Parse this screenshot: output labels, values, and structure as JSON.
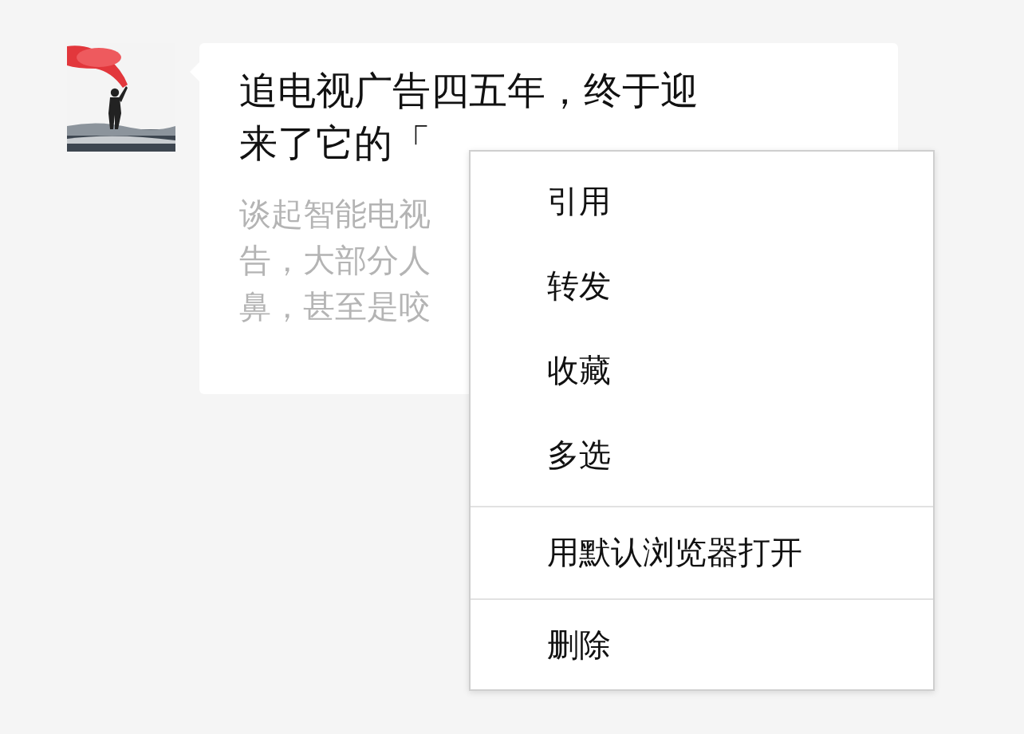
{
  "message": {
    "kind": "picture",
    "title_lines": [
      "追电视广告四五年，终于迎",
      "来了它的「"
    ],
    "description_lines": [
      "谈起智能电视",
      "告，大部分人",
      "鼻，甚至是咬"
    ]
  },
  "context_menu": {
    "sections": [
      {
        "items": [
          "引用",
          "转发",
          "收藏",
          "多选"
        ]
      },
      {
        "items": [
          "用默认浏览器打开"
        ]
      },
      {
        "items": [
          "删除"
        ]
      }
    ]
  }
}
